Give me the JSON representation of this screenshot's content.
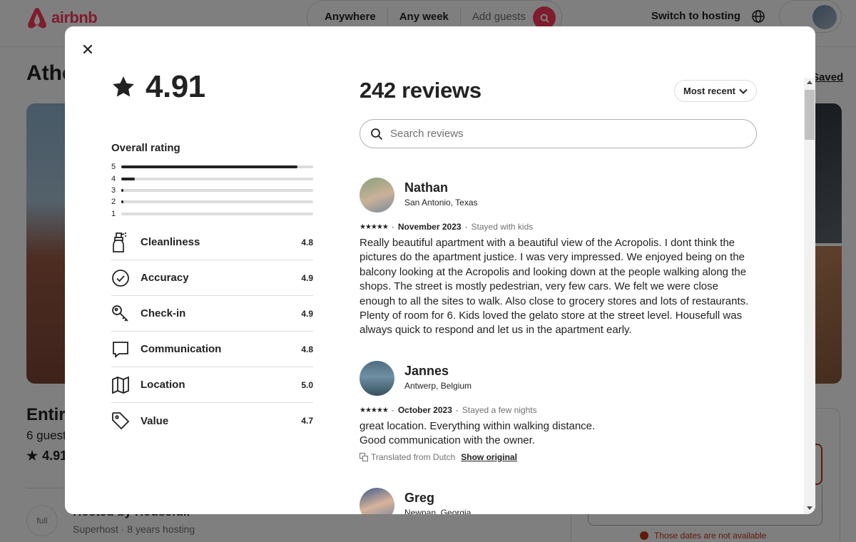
{
  "header": {
    "brand": "airbnb",
    "search_anywhere": "Anywhere",
    "search_week": "Any week",
    "search_guests": "Add guests",
    "switch_to_hosting": "Switch to hosting"
  },
  "listing": {
    "title_partial": "Athe",
    "saved_label": "Saved",
    "entire_partial": "Entire",
    "guests_partial": "6 guests",
    "rating": "4.91",
    "hosted_by": "Hosted by Housefull",
    "host_meta": "Superhost · 8 years hosting",
    "host_logo_text": "full",
    "booking_warning": "Those dates are not available"
  },
  "modal": {
    "rating_value": "4.91",
    "overall_label": "Overall rating",
    "distribution": [
      {
        "stars": "5",
        "fraction": 0.92
      },
      {
        "stars": "4",
        "fraction": 0.07
      },
      {
        "stars": "3",
        "fraction": 0.01
      },
      {
        "stars": "2",
        "fraction": 0.01
      },
      {
        "stars": "1",
        "fraction": 0.0
      }
    ],
    "categories": [
      {
        "name": "Cleanliness",
        "value": "4.8",
        "icon": "spray-bottle-icon"
      },
      {
        "name": "Accuracy",
        "value": "4.9",
        "icon": "check-circle-icon"
      },
      {
        "name": "Check-in",
        "value": "4.9",
        "icon": "key-icon"
      },
      {
        "name": "Communication",
        "value": "4.8",
        "icon": "message-icon"
      },
      {
        "name": "Location",
        "value": "5.0",
        "icon": "map-icon"
      },
      {
        "name": "Value",
        "value": "4.7",
        "icon": "tag-icon"
      }
    ],
    "reviews_count_title": "242 reviews",
    "sort_label": "Most recent",
    "search_placeholder": "Search reviews",
    "reviews": [
      {
        "name": "Nathan",
        "location": "San Antonio, Texas",
        "date": "November 2023",
        "stay": "Stayed with kids",
        "text": "Really beautiful apartment with a beautiful view of the Acropolis. I dont think the pictures do the apartment justice. I was very impressed. We enjoyed being on the balcony looking at the Acropolis and looking down at the people walking along the shops. The street is mostly pedestrian, very few cars. We felt we were close enough to all the sites to walk. Also close to grocery stores and lots of restaurants. Plenty of room for 6. Kids loved the gelato store at the street level. Housefull was always quick to respond and let us in the apartment early.",
        "avatar_color": "#b9a38c"
      },
      {
        "name": "Jannes",
        "location": "Antwerp, Belgium",
        "date": "October 2023",
        "stay": "Stayed a few nights",
        "text_line1": "great location. Everything within walking distance.",
        "text_line2": "Good communication with the owner.",
        "translated_label": "Translated from Dutch",
        "show_original": "Show original",
        "avatar_color": "#4f6d80"
      },
      {
        "name": "Greg",
        "location": "Newnan, Georgia",
        "avatar_color": "#6b7fa0"
      }
    ],
    "stars_glyph": "★★★★★",
    "separator": "·"
  }
}
